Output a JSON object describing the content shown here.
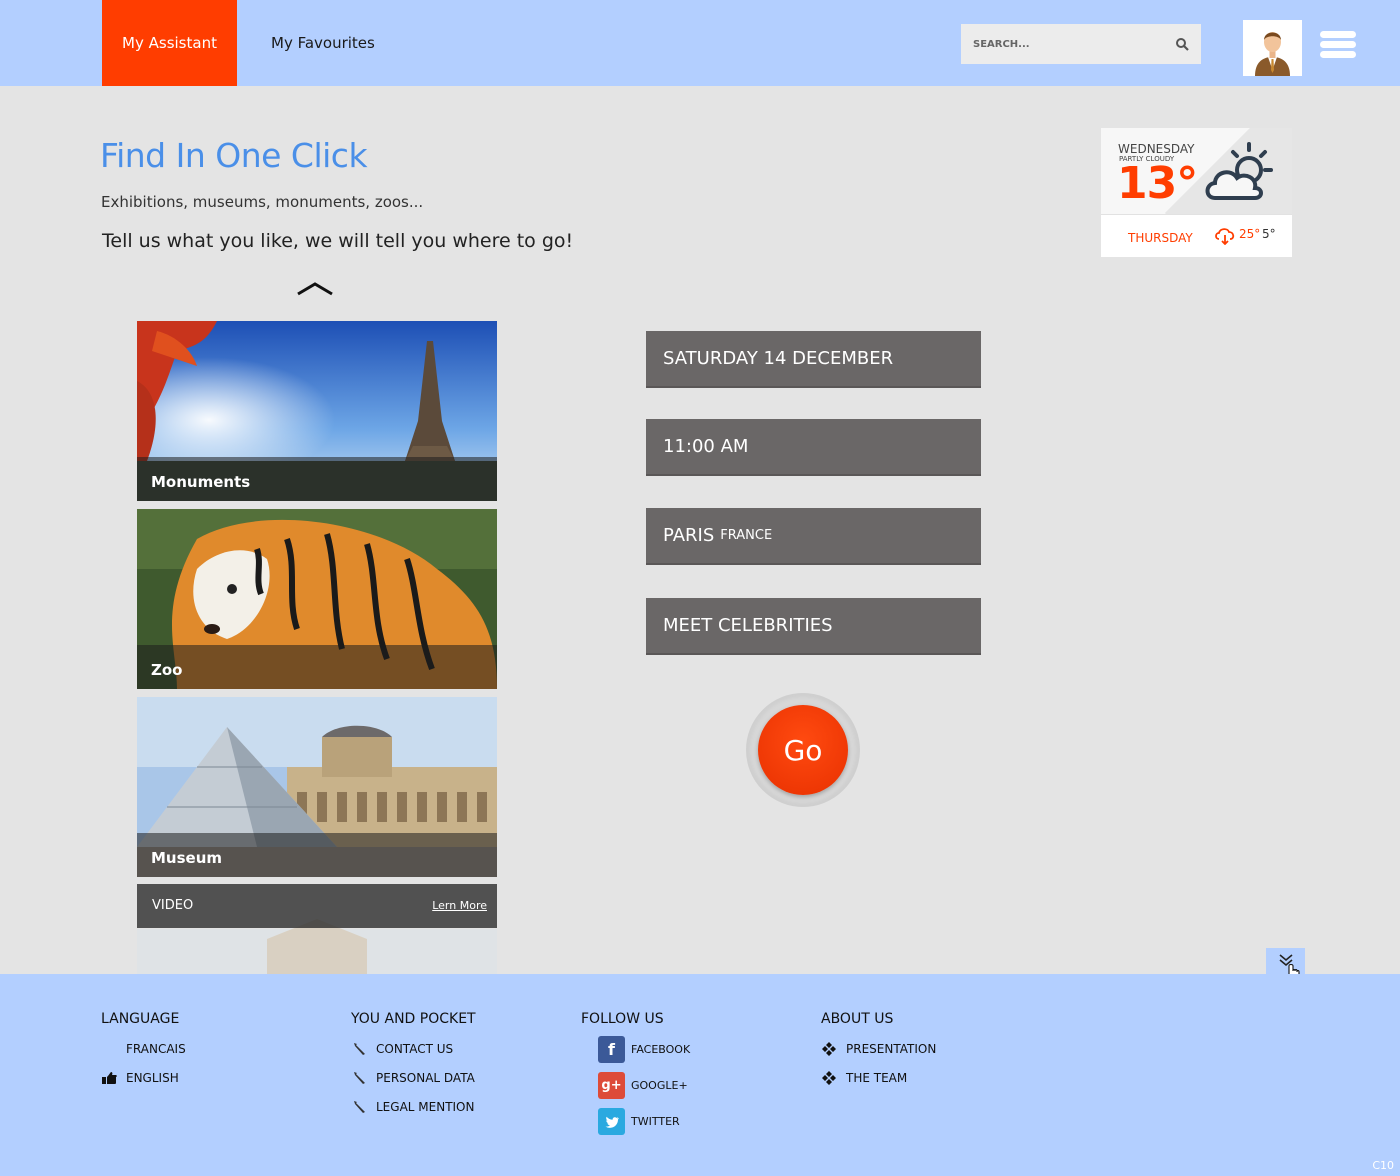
{
  "header": {
    "tabs": [
      {
        "label": "My Assistant",
        "active": true
      },
      {
        "label": "My Favourites",
        "active": false
      }
    ],
    "search_placeholder": "SEARCH...",
    "accent_color": "#ff3d00",
    "bar_color": "#b3cfff"
  },
  "hero": {
    "title": "Find In One Click",
    "subtitle": "Exhibitions, museums, monuments, zoos...",
    "tagline": "Tell us what you like, we will tell you where to go!"
  },
  "weather": {
    "day": "WEDNESDAY",
    "condition": "PARTLY CLOUDY",
    "temperature": "13°",
    "next_day": "THURSDAY",
    "next_high": "25°",
    "next_low": "5°"
  },
  "categories": [
    {
      "label": "Monuments"
    },
    {
      "label": "Zoo"
    },
    {
      "label": "Museum"
    }
  ],
  "video": {
    "label": "VIDEO",
    "link": "Lern More"
  },
  "fields": {
    "date": "SATURDAY 14 DECEMBER",
    "time": "11:00 AM",
    "city": "PARIS",
    "country": "FRANCE",
    "activity": "MEET CELEBRITIES"
  },
  "go_label": "Go",
  "footer": {
    "language": {
      "title": "LANGUAGE",
      "items": [
        "FRANCAIS",
        "ENGLISH"
      ],
      "selected": "ENGLISH"
    },
    "you_and_pocket": {
      "title": "YOU AND POCKET",
      "items": [
        "CONTACT US",
        "PERSONAL DATA",
        "LEGAL MENTION"
      ]
    },
    "follow_us": {
      "title": "FOLLOW US",
      "items": [
        "FACEBOOK",
        "GOOGLE+",
        "TWITTER"
      ]
    },
    "about_us": {
      "title": "ABOUT US",
      "items": [
        "PRESENTATION",
        "THE TEAM"
      ]
    },
    "corner_text": "C10"
  }
}
